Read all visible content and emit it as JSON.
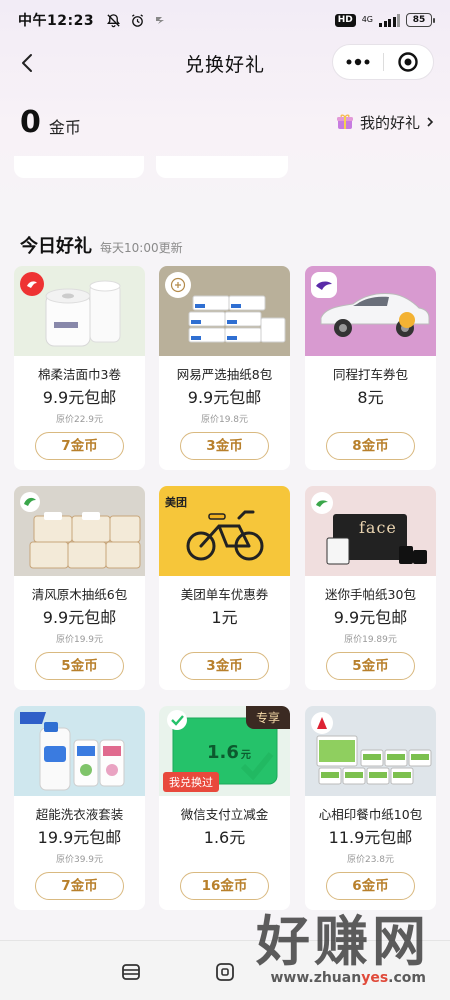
{
  "status_bar": {
    "time": "中午12:23",
    "hd": "HD",
    "network": "4G",
    "battery": "85"
  },
  "nav": {
    "title": "兑换好礼"
  },
  "account": {
    "coins": "0",
    "coin_unit": "金币",
    "my_gifts_label": "我的好礼"
  },
  "section": {
    "title": "今日好礼",
    "subtitle": "每天10:00更新"
  },
  "products": [
    {
      "name": "棉柔洁面巾3卷",
      "price": "9.9元包邮",
      "original": "原价22.9元",
      "cost": "7金币"
    },
    {
      "name": "网易严选抽纸8包",
      "price": "9.9元包邮",
      "original": "原价19.8元",
      "cost": "3金币"
    },
    {
      "name": "同程打车券包",
      "price": "8元",
      "original": "",
      "cost": "8金币"
    },
    {
      "name": "清风原木抽纸6包",
      "price": "9.9元包邮",
      "original": "原价19.9元",
      "cost": "5金币"
    },
    {
      "name": "美团单车优惠券",
      "price": "1元",
      "original": "",
      "cost": "3金币"
    },
    {
      "name": "迷你手帕纸30包",
      "price": "9.9元包邮",
      "original": "原价19.89元",
      "cost": "5金币"
    },
    {
      "name": "超能洗衣液套装",
      "price": "19.9元包邮",
      "original": "原价39.9元",
      "cost": "7金币"
    },
    {
      "name": "微信支付立减金",
      "price": "1.6元",
      "original": "",
      "cost": "16金币"
    },
    {
      "name": "心相印餐巾纸10包",
      "price": "11.9元包邮",
      "original": "原价23.8元",
      "cost": "6金币"
    }
  ],
  "image_text": {
    "meituan": "美团",
    "wechat_amount": "1.6",
    "wechat_unit": "元",
    "exclusive_tag": "专享",
    "redeemed_tag": "我兑换过",
    "face_brand": "face"
  },
  "watermark": {
    "text": "好赚网",
    "url_prefix": "www.zhuan",
    "url_highlight": "yes",
    "url_suffix": ".com"
  },
  "colors": {
    "accent_gold": "#b8802c",
    "tag_red": "#e8493c"
  }
}
